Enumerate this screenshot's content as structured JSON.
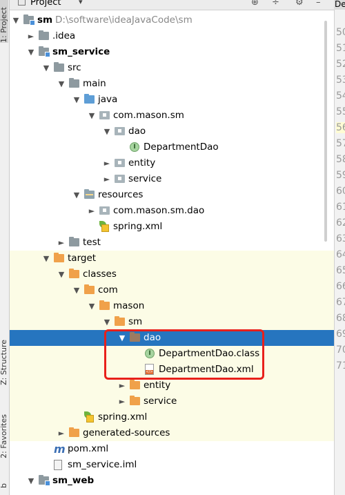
{
  "panel": {
    "title": "Project",
    "caret": "▾",
    "buttons": [
      "⊕",
      "÷",
      "⚙",
      "–"
    ]
  },
  "left_stripe": {
    "project_tab": "1: Project",
    "structure_tab": "Z: Structure",
    "favorites_tab": "2: Favorites",
    "web_tab": "b"
  },
  "editor": {
    "tab_label": "De",
    "line_numbers": [
      "50",
      "51",
      "52",
      "53",
      "54",
      "55",
      "56",
      "57",
      "58",
      "59",
      "60",
      "61",
      "62",
      "63",
      "64",
      "65",
      "66",
      "67",
      "68",
      "69",
      "70",
      "71"
    ],
    "current_line": "56"
  },
  "tree": [
    {
      "label": "sm",
      "path": "D:\\software\\ideaJavaCode\\sm",
      "depth": 0,
      "arrow": "open",
      "icon": "module-folder",
      "bold": true
    },
    {
      "label": ".idea",
      "depth": 1,
      "arrow": "closed",
      "icon": "folder-gray"
    },
    {
      "label": "sm_service",
      "depth": 1,
      "arrow": "open",
      "icon": "module-folder",
      "bold": true
    },
    {
      "label": "src",
      "depth": 2,
      "arrow": "open",
      "icon": "folder-gray"
    },
    {
      "label": "main",
      "depth": 3,
      "arrow": "open",
      "icon": "folder-gray"
    },
    {
      "label": "java",
      "depth": 4,
      "arrow": "open",
      "icon": "folder-blue"
    },
    {
      "label": "com.mason.sm",
      "depth": 5,
      "arrow": "open",
      "icon": "package"
    },
    {
      "label": "dao",
      "depth": 6,
      "arrow": "open",
      "icon": "package"
    },
    {
      "label": "DepartmentDao",
      "depth": 7,
      "arrow": "none",
      "icon": "interface"
    },
    {
      "label": "entity",
      "depth": 6,
      "arrow": "closed",
      "icon": "package"
    },
    {
      "label": "service",
      "depth": 6,
      "arrow": "closed",
      "icon": "package"
    },
    {
      "label": "resources",
      "depth": 4,
      "arrow": "open",
      "icon": "resources"
    },
    {
      "label": "com.mason.sm.dao",
      "depth": 5,
      "arrow": "closed",
      "icon": "package"
    },
    {
      "label": "spring.xml",
      "depth": 5,
      "arrow": "none",
      "icon": "spring"
    },
    {
      "label": "test",
      "depth": 3,
      "arrow": "closed",
      "icon": "folder-gray"
    },
    {
      "label": "target",
      "depth": 2,
      "arrow": "open",
      "icon": "folder-orange",
      "yellow": true
    },
    {
      "label": "classes",
      "depth": 3,
      "arrow": "open",
      "icon": "folder-orange",
      "yellow": true
    },
    {
      "label": "com",
      "depth": 4,
      "arrow": "open",
      "icon": "folder-orange",
      "yellow": true
    },
    {
      "label": "mason",
      "depth": 5,
      "arrow": "open",
      "icon": "folder-orange",
      "yellow": true
    },
    {
      "label": "sm",
      "depth": 6,
      "arrow": "open",
      "icon": "folder-orange",
      "yellow": true
    },
    {
      "label": "dao",
      "depth": 7,
      "arrow": "open",
      "icon": "folder-brown",
      "selected": true
    },
    {
      "label": "DepartmentDao.class",
      "depth": 8,
      "arrow": "none",
      "icon": "interface",
      "yellow": true
    },
    {
      "label": "DepartmentDao.xml",
      "depth": 8,
      "arrow": "none",
      "icon": "xml",
      "yellow": true
    },
    {
      "label": "entity",
      "depth": 7,
      "arrow": "closed",
      "icon": "folder-orange",
      "yellow": true
    },
    {
      "label": "service",
      "depth": 7,
      "arrow": "closed",
      "icon": "folder-orange",
      "yellow": true
    },
    {
      "label": "spring.xml",
      "depth": 4,
      "arrow": "none",
      "icon": "spring",
      "yellow": true
    },
    {
      "label": "generated-sources",
      "depth": 3,
      "arrow": "closed",
      "icon": "folder-orange",
      "yellow": true
    },
    {
      "label": "pom.xml",
      "depth": 2,
      "arrow": "none",
      "icon": "maven"
    },
    {
      "label": "sm_service.iml",
      "depth": 2,
      "arrow": "none",
      "icon": "iml"
    },
    {
      "label": "sm_web",
      "depth": 1,
      "arrow": "open",
      "icon": "module-folder",
      "bold": true
    }
  ],
  "colors": {
    "selection": "#2675bf",
    "excluded_bg": "#fcfce6",
    "highlight_box": "#e8201b"
  }
}
